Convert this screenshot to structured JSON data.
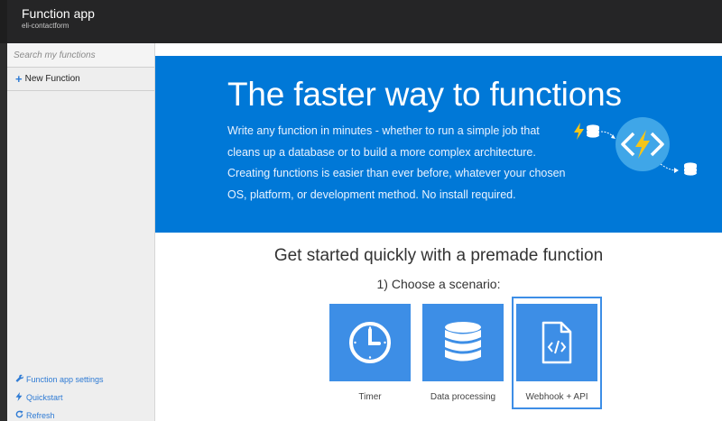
{
  "header": {
    "title": "Function app",
    "subtitle": "eli-contactform"
  },
  "sidebar": {
    "search_placeholder": "Search my functions",
    "new_function_label": "New Function",
    "links": [
      {
        "label": "Function app settings",
        "icon": "wrench-icon"
      },
      {
        "label": "Quickstart",
        "icon": "lightning-icon"
      },
      {
        "label": "Refresh",
        "icon": "refresh-icon"
      }
    ]
  },
  "hero": {
    "title": "The faster way to functions",
    "body": "Write any function in minutes - whether to run a simple job that cleans up a database or to build a more complex architecture. Creating functions is easier than ever before, whatever your chosen OS, platform, or development method. No install required."
  },
  "quickstart": {
    "title": "Get started quickly with a premade function",
    "step1": "1) Choose a scenario:",
    "scenarios": [
      {
        "label": "Timer",
        "icon": "clock-icon",
        "selected": false
      },
      {
        "label": "Data processing",
        "icon": "database-icon",
        "selected": false
      },
      {
        "label": "Webhook + API",
        "icon": "code-file-icon",
        "selected": true
      }
    ]
  },
  "colors": {
    "accent": "#0078d7",
    "tile": "#3d8ee6",
    "topbar": "#252526",
    "bolt": "#f5c518"
  }
}
